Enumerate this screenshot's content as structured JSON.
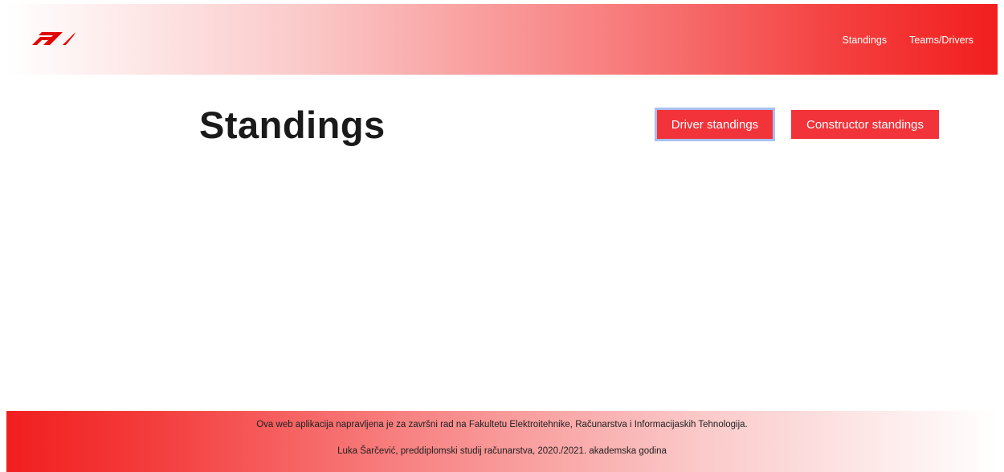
{
  "header": {
    "logo": "f1-logo",
    "nav": [
      {
        "label": "Standings"
      },
      {
        "label": "Teams/Drivers"
      }
    ]
  },
  "main": {
    "title": "Standings",
    "buttons": {
      "driver": "Driver standings",
      "constructor": "Constructor standings"
    }
  },
  "footer": {
    "line1": "Ova web aplikacija napravljena je za završni rad na Fakultetu Elektroitehnike, Računarstva i Informacijaskih Tehnologija.",
    "line2": "Luka Šarčević, preddiplomski studij računarstva, 2020./2021. akademska godina"
  },
  "colors": {
    "accent": "#f3333a",
    "focus_outline": "#a9bff0",
    "title_text": "#1a1a1a"
  }
}
